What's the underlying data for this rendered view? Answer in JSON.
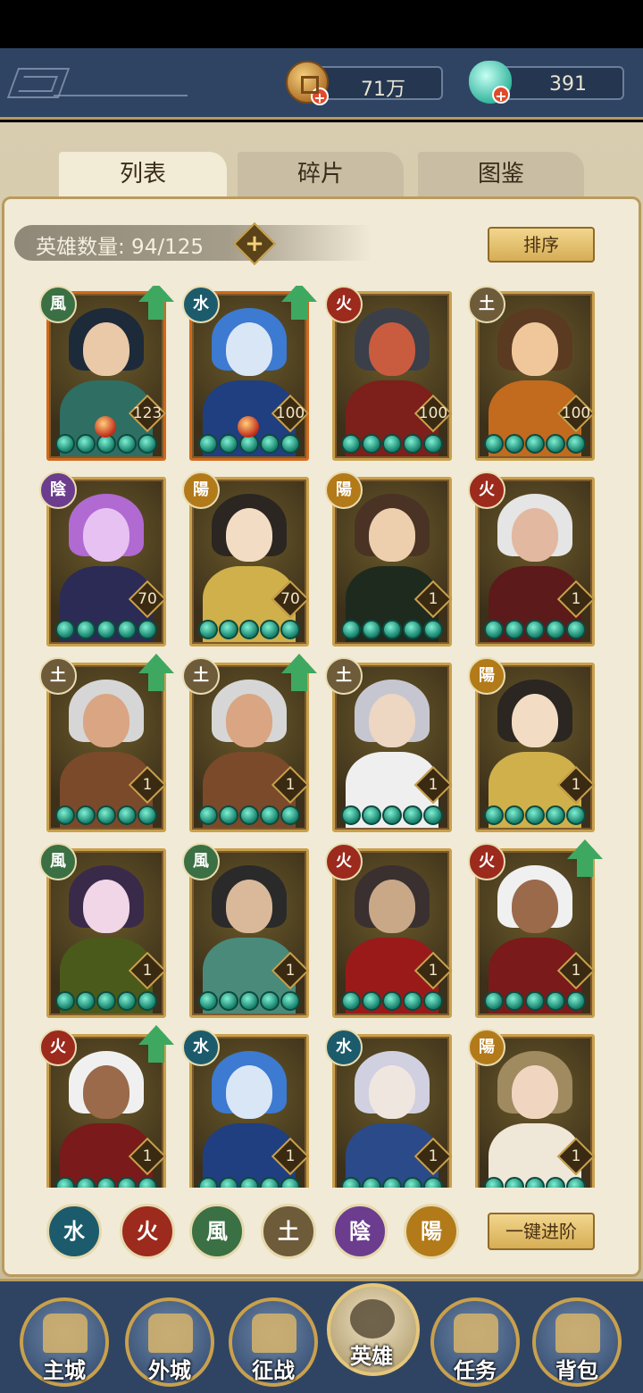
{
  "resources": {
    "coins": "71万",
    "gems": "391"
  },
  "tabs": [
    "列表",
    "碎片",
    "图鉴"
  ],
  "hero_count": "英雄数量: 94/125",
  "sort_label": "排序",
  "advance_label": "一键进阶",
  "elements": {
    "fire": "火",
    "water": "水",
    "wind": "風",
    "earth": "土",
    "yin": "陰",
    "yang": "陽"
  },
  "heroes": [
    {
      "element": "風",
      "level": "123",
      "upgrade": true,
      "orange": true
    },
    {
      "element": "水",
      "level": "100",
      "upgrade": true,
      "orange": true
    },
    {
      "element": "火",
      "level": "100",
      "upgrade": false
    },
    {
      "element": "土",
      "level": "100",
      "upgrade": false
    },
    {
      "element": "陰",
      "level": "70",
      "upgrade": false
    },
    {
      "element": "陽",
      "level": "70",
      "upgrade": false
    },
    {
      "element": "陽",
      "level": "1",
      "upgrade": false
    },
    {
      "element": "火",
      "level": "1",
      "upgrade": false
    },
    {
      "element": "土",
      "level": "1",
      "upgrade": true
    },
    {
      "element": "土",
      "level": "1",
      "upgrade": true
    },
    {
      "element": "土",
      "level": "1",
      "upgrade": false
    },
    {
      "element": "陽",
      "level": "1",
      "upgrade": false
    },
    {
      "element": "風",
      "level": "1",
      "upgrade": false
    },
    {
      "element": "風",
      "level": "1",
      "upgrade": false
    },
    {
      "element": "火",
      "level": "1",
      "upgrade": false
    },
    {
      "element": "火",
      "level": "1",
      "upgrade": true
    },
    {
      "element": "火",
      "level": "1",
      "upgrade": true
    },
    {
      "element": "水",
      "level": "1",
      "upgrade": false
    },
    {
      "element": "水",
      "level": "1",
      "upgrade": false
    },
    {
      "element": "陽",
      "level": "1",
      "upgrade": false
    }
  ],
  "nav": [
    "主城",
    "外城",
    "征战",
    "英雄",
    "任务",
    "背包"
  ],
  "nav_active": "英雄"
}
